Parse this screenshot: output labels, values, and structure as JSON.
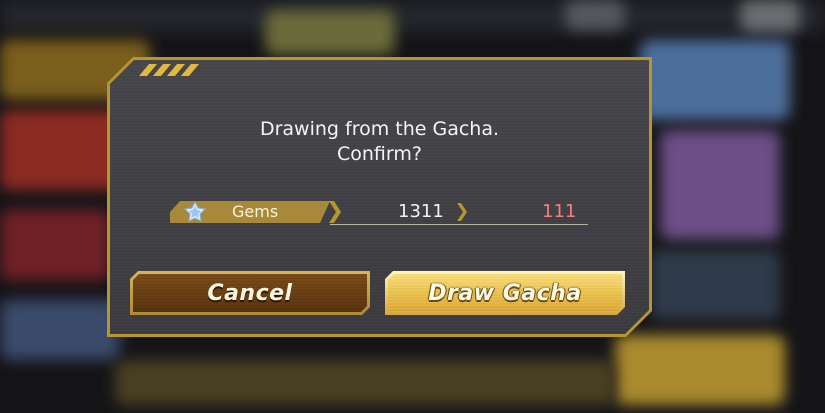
{
  "dialog": {
    "message_line1": "Drawing from the Gacha.",
    "message_line2": "Confirm?"
  },
  "cost": {
    "currency_label": "Gems",
    "currency_icon": "gem-icon",
    "current_amount": "1311",
    "after_amount": "111"
  },
  "buttons": {
    "cancel_label": "Cancel",
    "draw_label": "Draw Gacha"
  },
  "colors": {
    "frame_gold": "#b8962f",
    "accent_stripe": "#e2b93c",
    "after_amount": "#f08080",
    "cancel_button": "#6b4015",
    "draw_button": "#e8bd45"
  }
}
